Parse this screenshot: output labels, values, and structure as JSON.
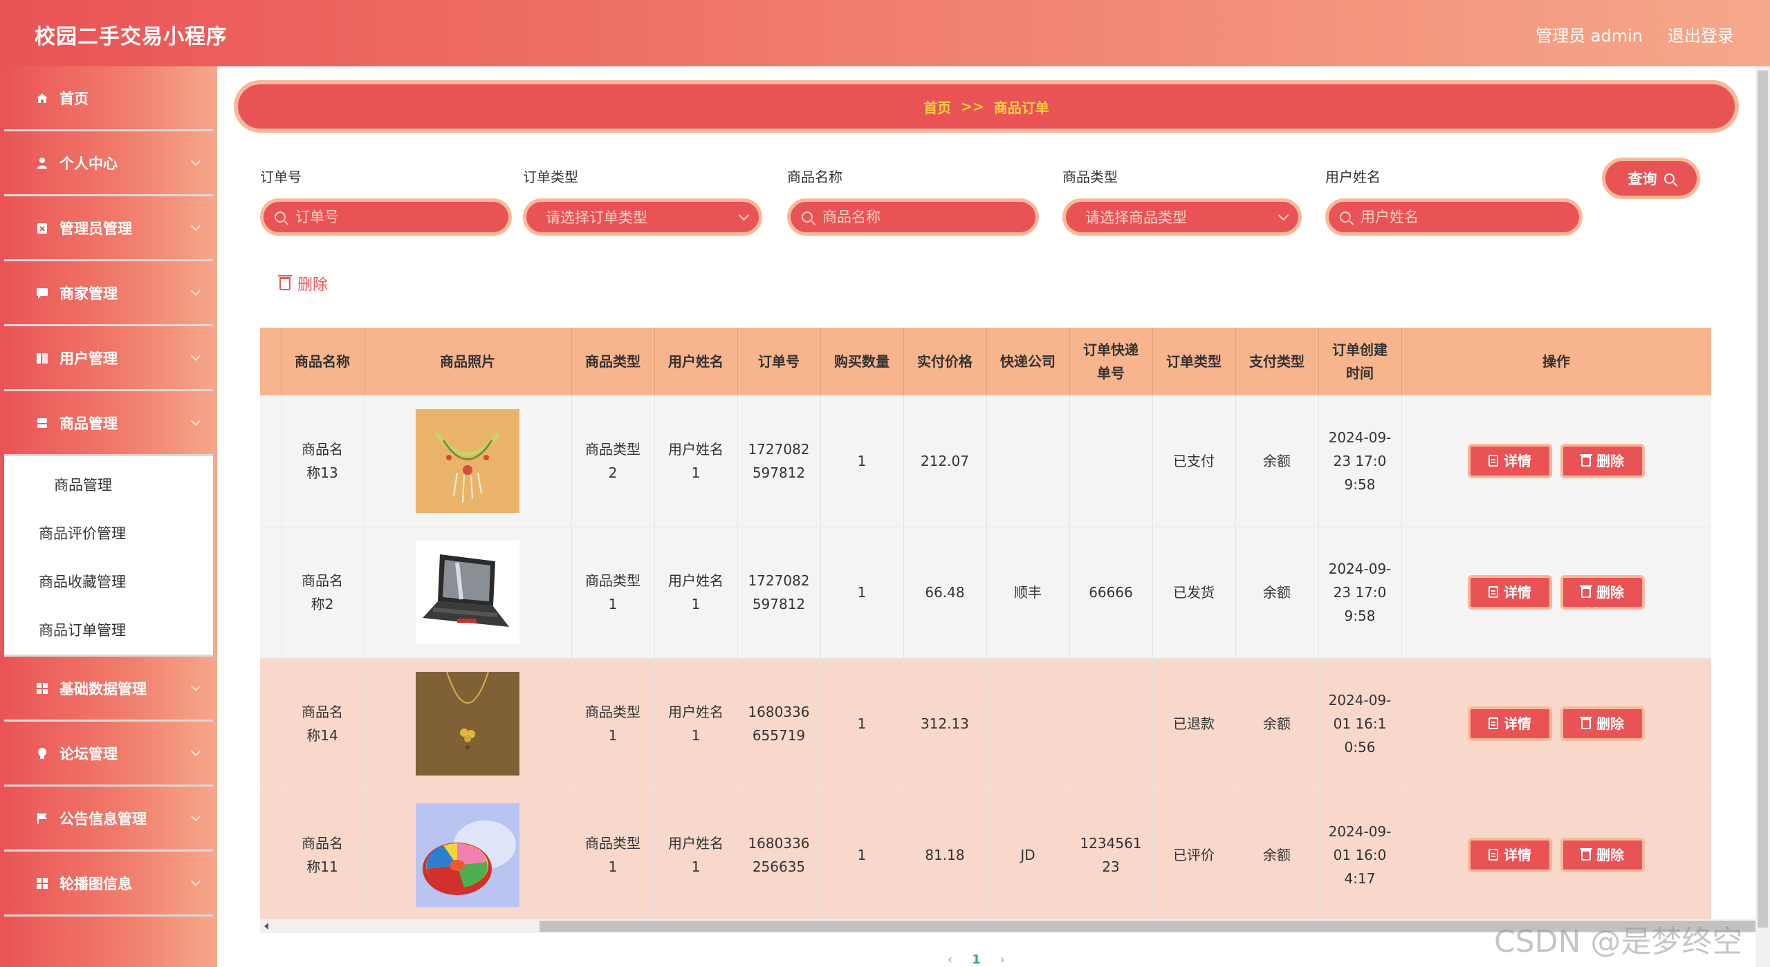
{
  "header": {
    "title": "校园二手交易小程序",
    "user": "管理员 admin",
    "logout": "退出登录"
  },
  "sidebar": {
    "items": [
      {
        "label": "首页",
        "icon": "home-icon"
      },
      {
        "label": "个人中心",
        "icon": "user-icon"
      },
      {
        "label": "管理员管理",
        "icon": "admin-icon"
      },
      {
        "label": "商家管理",
        "icon": "chat-icon"
      },
      {
        "label": "用户管理",
        "icon": "users-icon"
      },
      {
        "label": "商品管理",
        "icon": "goods-icon"
      }
    ],
    "submenu": [
      "商品管理",
      "商品评价管理",
      "商品收藏管理",
      "商品订单管理"
    ],
    "items_after": [
      {
        "label": "基础数据管理",
        "icon": "grid-icon"
      },
      {
        "label": "论坛管理",
        "icon": "bulb-icon"
      },
      {
        "label": "公告信息管理",
        "icon": "flag-icon"
      },
      {
        "label": "轮播图信息",
        "icon": "grid-icon"
      }
    ]
  },
  "breadcrumb": {
    "home": "首页",
    "sep": ">>",
    "current": "商品订单"
  },
  "search": {
    "order_no": {
      "label": "订单号",
      "placeholder": "订单号"
    },
    "order_type": {
      "label": "订单类型",
      "placeholder": "请选择订单类型"
    },
    "goods_name": {
      "label": "商品名称",
      "placeholder": "商品名称"
    },
    "goods_type": {
      "label": "商品类型",
      "placeholder": "请选择商品类型"
    },
    "user_name": {
      "label": "用户姓名",
      "placeholder": "用户姓名"
    },
    "query": "查询"
  },
  "delete_label": "删除",
  "table": {
    "headers": [
      "商品名称",
      "商品照片",
      "商品类型",
      "用户姓名",
      "订单号",
      "购买数量",
      "实付价格",
      "快递公司",
      "订单快递单号",
      "订单类型",
      "支付类型",
      "订单创建时间",
      "操作"
    ],
    "detail_label": "详情",
    "delete_label": "删除",
    "rows": [
      {
        "name": "商品名称13",
        "type": "商品类型2",
        "user": "用户姓名1",
        "order_no": "1727082597812",
        "qty": "1",
        "price": "212.07",
        "express": "",
        "express_no": "",
        "order_type": "已支付",
        "pay": "余额",
        "time": "2024-09-23 17:09:58",
        "photo": "necklace"
      },
      {
        "name": "商品名称2",
        "type": "商品类型1",
        "user": "用户姓名1",
        "order_no": "1727082597812",
        "qty": "1",
        "price": "66.48",
        "express": "顺丰",
        "express_no": "66666",
        "order_type": "已发货",
        "pay": "余额",
        "time": "2024-09-23 17:09:58",
        "photo": "laptop"
      },
      {
        "name": "商品名称14",
        "type": "商品类型1",
        "user": "用户姓名1",
        "order_no": "1680336655719",
        "qty": "1",
        "price": "312.13",
        "express": "",
        "express_no": "",
        "order_type": "已退款",
        "pay": "余额",
        "time": "2024-09-01 16:10:56",
        "photo": "pendant"
      },
      {
        "name": "商品名称11",
        "type": "商品类型1",
        "user": "用户姓名1",
        "order_no": "1680336256635",
        "qty": "1",
        "price": "81.18",
        "express": "JD",
        "express_no": "123456123",
        "order_type": "已评价",
        "pay": "余额",
        "time": "2024-09-01 16:04:17",
        "photo": "tray"
      }
    ]
  },
  "pager": {
    "prev": "‹",
    "current": "1",
    "next": "›"
  },
  "watermark": "CSDN @是梦终空"
}
